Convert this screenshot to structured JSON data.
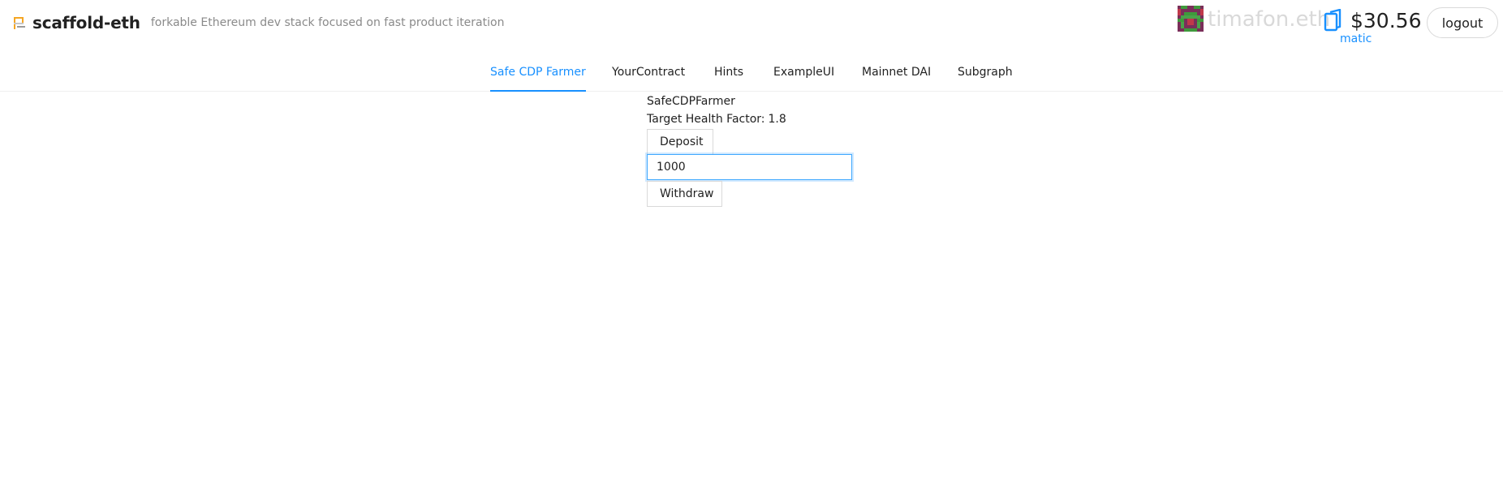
{
  "header": {
    "title": "scaffold-eth",
    "subtitle": "forkable Ethereum dev stack focused on fast product iteration"
  },
  "account": {
    "ens_name": "timafon.eth",
    "balance": "$30.56",
    "network": "matic",
    "logout_label": "logout",
    "icons": [
      "scaffold-icon",
      "blockie-avatar",
      "wallet-icon"
    ]
  },
  "nav": {
    "tabs": [
      {
        "label": "Safe CDP Farmer",
        "active": true
      },
      {
        "label": "YourContract",
        "active": false
      },
      {
        "label": "Hints",
        "active": false
      },
      {
        "label": "ExampleUI",
        "active": false
      },
      {
        "label": "Mainnet DAI",
        "active": false
      },
      {
        "label": "Subgraph",
        "active": false
      }
    ]
  },
  "contract": {
    "name": "SafeCDPFarmer",
    "health_label": "Target Health Factor:",
    "health_value": "1.8",
    "deposit_label": "Deposit",
    "amount_value": "1000",
    "withdraw_label": "Withdraw"
  },
  "colors": {
    "accent": "#1890ff",
    "ens_name": "#d9d9d9",
    "subtitle": "#8a8a8a",
    "border": "#d9d9d9"
  }
}
